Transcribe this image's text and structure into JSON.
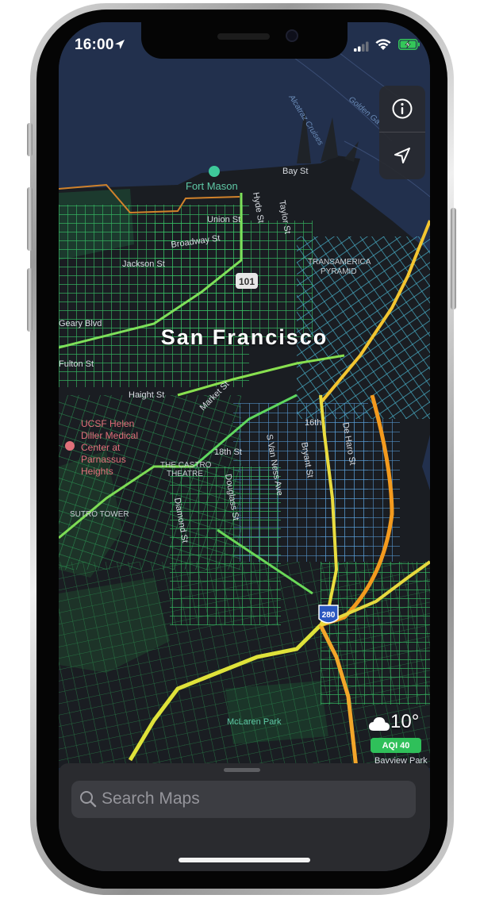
{
  "status_bar": {
    "time": "16:00",
    "icons": [
      "location-arrow-icon",
      "cellular-signal-icon",
      "wifi-icon",
      "battery-charging-icon"
    ],
    "battery_color": "#34c759"
  },
  "map": {
    "city_label": "San Francisco",
    "controls": {
      "info_icon": "info-icon",
      "location_icon": "location-arrow-icon"
    },
    "labels": {
      "fort_mason": "Fort Mason",
      "bay_st": "Bay St",
      "union_st": "Union St",
      "broadway": "Broadway St",
      "jackson": "Jackson St",
      "hyde": "Hyde St",
      "taylor": "Taylor St",
      "transamerica": "TRANSAMERICA",
      "pyramid": "PYRAMID",
      "geary": "Geary Blvd",
      "haight": "Haight St",
      "fulton": "Fulton St",
      "castro_theatre_1": "THE CASTRO",
      "castro_theatre_2": "THEATRE",
      "sutro": "SUTRO TOWER",
      "diamond": "Diamond St",
      "ucsf_1": "UCSF Helen",
      "ucsf_2": "Diller Medical",
      "ucsf_3": "Center at",
      "ucsf_4": "Parnassus",
      "ucsf_5": "Heights",
      "alcatraz": "Alcatraz Cruises",
      "golden_gate": "Golden Ga",
      "s_van_ness": "S Van Ness Ave",
      "bryant": "Bryant St",
      "de_haro": "De Haro St",
      "douglass": "Douglass St",
      "market": "Market St",
      "eighteenth": "18th St",
      "sixteenth": "16th",
      "bayview": "Bayview Park",
      "mclaren": "McLaren Park",
      "route_101": "101",
      "route_280": "280"
    },
    "colors": {
      "road_green": "#3fd46a",
      "road_yellow": "#e8d84a",
      "road_orange": "#f39a1e",
      "road_blue": "#5aa9e8",
      "water": "#22304d",
      "land": "#1a1d22",
      "park": "#1c3a2e"
    }
  },
  "weather": {
    "icon": "cloud-icon",
    "temperature": "10°",
    "aqi": "AQI 40",
    "aqi_color": "#2fc05a"
  },
  "bottom_sheet": {
    "search_placeholder": "Search Maps",
    "search_icon": "search-icon"
  }
}
